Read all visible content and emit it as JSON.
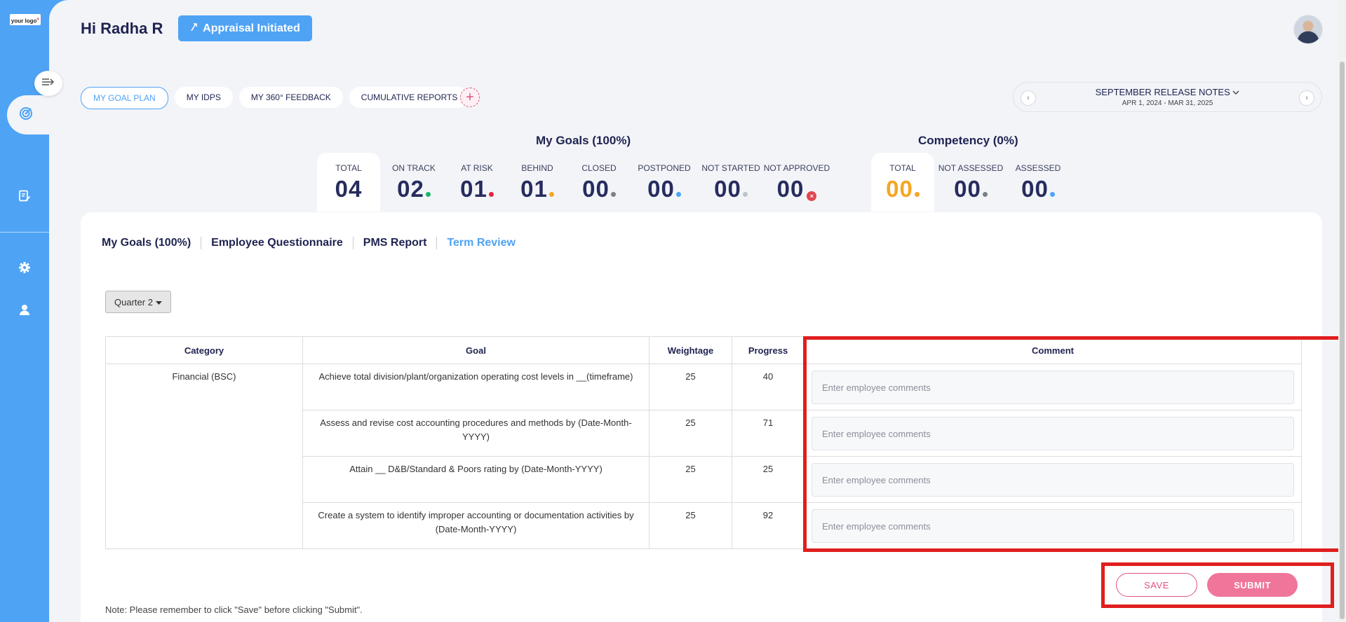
{
  "brand": {
    "logo_text": "your logo",
    "logo_mark": "®"
  },
  "header": {
    "greeting": "Hi Radha R",
    "status_label": "Appraisal Initiated"
  },
  "pill_tabs": [
    "MY GOAL PLAN",
    "MY IDPS",
    "MY 360° FEEDBACK",
    "CUMULATIVE REPORTS"
  ],
  "release": {
    "title": "SEPTEMBER RELEASE NOTES",
    "dates": "APR 1, 2024 - MAR 31, 2025"
  },
  "goals_summary": {
    "title": "My Goals (100%)",
    "stats": [
      {
        "label": "TOTAL",
        "value": "04"
      },
      {
        "label": "ON TRACK",
        "value": "02",
        "color": "#1fb36b"
      },
      {
        "label": "AT RISK",
        "value": "01",
        "color": "#e2273a"
      },
      {
        "label": "BEHIND",
        "value": "01",
        "color": "#f5a623"
      },
      {
        "label": "CLOSED",
        "value": "00",
        "color": "#7c7f87"
      },
      {
        "label": "POSTPONED",
        "value": "00",
        "color": "#4ea3f5"
      },
      {
        "label": "NOT STARTED",
        "value": "00",
        "color": "#bfc3ca"
      },
      {
        "label": "NOT APPROVED",
        "value": "00",
        "color": "#e2464f"
      }
    ]
  },
  "competency": {
    "title": "Competency (0%)",
    "stats": [
      {
        "label": "TOTAL",
        "value": "00",
        "color": "#f5a623"
      },
      {
        "label": "NOT ASSESSED",
        "value": "00",
        "color": "#7c7f87"
      },
      {
        "label": "ASSESSED",
        "value": "00",
        "color": "#4ea3f5"
      }
    ]
  },
  "subtabs": [
    "My Goals (100%)",
    "Employee Questionnaire",
    "PMS Report",
    "Term Review"
  ],
  "quarter": "Quarter 2",
  "table": {
    "headers": [
      "Category",
      "Goal",
      "Weightage",
      "Progress",
      "Comment"
    ],
    "category": "Financial (BSC)",
    "comment_placeholder": "Enter employee comments",
    "rows": [
      {
        "goal": "Achieve total division/plant/organization operating cost levels in __(timeframe)",
        "weightage": "25",
        "progress": "40"
      },
      {
        "goal": "Assess and revise cost accounting procedures and methods by (Date-Month-YYYY)",
        "weightage": "25",
        "progress": "71"
      },
      {
        "goal": "Attain __ D&B/Standard & Poors rating by (Date-Month-YYYY)",
        "weightage": "25",
        "progress": "25"
      },
      {
        "goal": "Create a system to identify improper accounting or documentation activities by (Date-Month-YYYY)",
        "weightage": "25",
        "progress": "92"
      }
    ]
  },
  "actions": {
    "save": "SAVE",
    "submit": "SUBMIT"
  },
  "note": "Note: Please remember to click \"Save\" before clicking \"Submit\".",
  "colors": {
    "brand_blue": "#4ea3f5",
    "accent_pink": "#e0537d",
    "highlight_red": "#e01e1e"
  }
}
